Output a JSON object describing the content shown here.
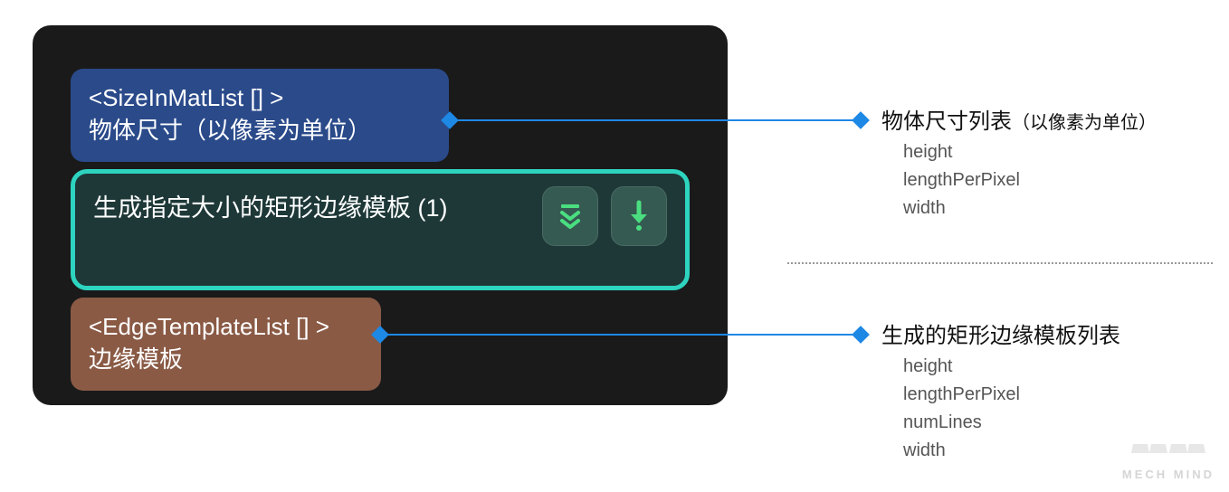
{
  "dark_panel": {
    "blue": {
      "type_line": "<SizeInMatList [] >",
      "label_prefix": "物体尺寸",
      "label_note": "（以像素为单位）"
    },
    "teal": {
      "title": "生成指定大小的矩形边缘模板 (1)",
      "icon1_name": "expand-down-icon",
      "icon2_name": "download-icon"
    },
    "brown": {
      "type_line": "<EdgeTemplateList [] >",
      "label": "边缘模板"
    }
  },
  "annotations": {
    "top": {
      "title": "物体尺寸列表",
      "note": "（以像素为单位）",
      "fields": [
        "height",
        "lengthPerPixel",
        "width"
      ]
    },
    "bottom": {
      "title": "生成的矩形边缘模板列表",
      "fields": [
        "height",
        "lengthPerPixel",
        "numLines",
        "width"
      ]
    }
  },
  "watermark": {
    "text": "MECH MIND"
  },
  "colors": {
    "accent_blue": "#1e88e5",
    "teal_border": "#2dd4bf",
    "icon_green": "#4ade80"
  }
}
